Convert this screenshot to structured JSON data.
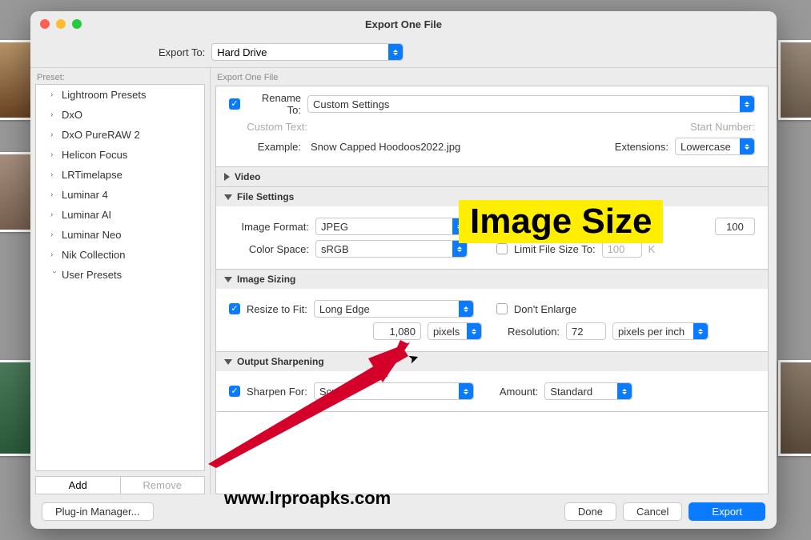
{
  "window": {
    "title": "Export One File",
    "export_to_label": "Export To:",
    "export_to_value": "Hard Drive"
  },
  "sidebar": {
    "header": "Preset:",
    "items": [
      {
        "label": "Lightroom Presets",
        "open": false
      },
      {
        "label": "DxO",
        "open": false
      },
      {
        "label": "DxO PureRAW 2",
        "open": false
      },
      {
        "label": "Helicon Focus",
        "open": false
      },
      {
        "label": "LRTimelapse",
        "open": false
      },
      {
        "label": "Luminar 4",
        "open": false
      },
      {
        "label": "Luminar AI",
        "open": false
      },
      {
        "label": "Luminar Neo",
        "open": false
      },
      {
        "label": "Nik Collection",
        "open": false
      },
      {
        "label": "User Presets",
        "open": true
      }
    ],
    "add": "Add",
    "remove": "Remove"
  },
  "main": {
    "header": "Export One File",
    "naming": {
      "rename_label": "Rename To:",
      "rename_value": "Custom Settings",
      "custom_text_label": "Custom Text:",
      "start_number_label": "Start Number:",
      "example_label": "Example:",
      "example_value": "Snow Capped Hoodoos2022.jpg",
      "extensions_label": "Extensions:",
      "extensions_value": "Lowercase"
    },
    "video_header": "Video",
    "file_settings": {
      "header": "File Settings",
      "format_label": "Image Format:",
      "format_value": "JPEG",
      "quality_value": "100",
      "colorspace_label": "Color Space:",
      "colorspace_value": "sRGB",
      "limit_label": "Limit File Size To:",
      "limit_value": "100",
      "limit_unit": "K"
    },
    "image_sizing": {
      "header": "Image Sizing",
      "resize_label": "Resize to Fit:",
      "resize_value": "Long Edge",
      "dont_enlarge": "Don't Enlarge",
      "dimension": "1,080",
      "dim_unit": "pixels",
      "resolution_label": "Resolution:",
      "resolution_value": "72",
      "resolution_unit": "pixels per inch"
    },
    "output_sharpening": {
      "header": "Output Sharpening",
      "sharpen_for_label": "Sharpen For:",
      "sharpen_for_value": "Screen",
      "amount_label": "Amount:",
      "amount_value": "Standard"
    }
  },
  "footer": {
    "plugin": "Plug-in Manager...",
    "done": "Done",
    "cancel": "Cancel",
    "export": "Export"
  },
  "annotation": {
    "highlight": "Image Size",
    "watermark": "www.lrproapks.com"
  }
}
